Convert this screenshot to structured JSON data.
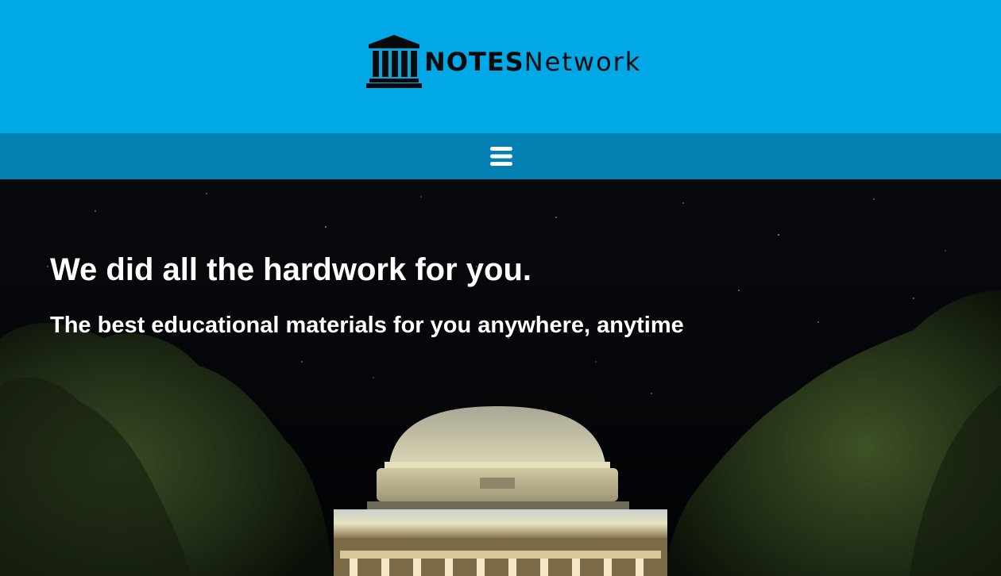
{
  "header": {
    "logo": {
      "icon": "building-columns-icon",
      "text_bold": "NOTES",
      "text_light": "Network"
    },
    "background_color": "#00a8e6"
  },
  "navbar": {
    "menu_icon": "hamburger-menu-icon",
    "background_color": "#0380b2"
  },
  "hero": {
    "title": "We did all the hardwork for you.",
    "subtitle": "The best educational materials for you anywhere, anytime",
    "background": "night-campus-dome-photo"
  }
}
